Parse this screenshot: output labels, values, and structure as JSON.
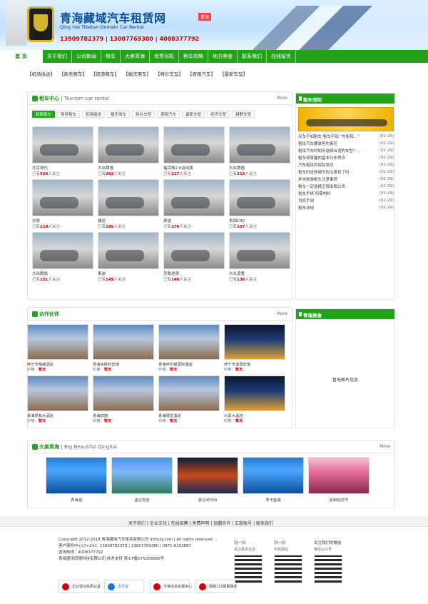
{
  "header": {
    "site_name": "青海藏域汽车租赁网",
    "site_name_en": "Qing Hai Tibetan Domain Car Rental",
    "badge": "青海",
    "hotline": "13909782379 | 13007769380 | 4008377792"
  },
  "nav": {
    "items": [
      "首 页",
      "关于我们",
      "公司新闻",
      "租车",
      "大美青海",
      "优秀司机",
      "租车攻略",
      "地方美食",
      "联系我们",
      "在线留言"
    ]
  },
  "tags": [
    "【机场接送】",
    "【商务租车】",
    "【旅游租车】",
    "【婚庆用车】",
    "【特价车型】",
    "【周租汽车】",
    "【最新车型】"
  ],
  "rent_center": {
    "title": "租车中心",
    "subtitle": "Tourism car rental",
    "more": "More",
    "tabs": [
      "新款租车",
      "商务租车",
      "机场接送",
      "婚庆用车",
      "特价车型",
      "周租汽车",
      "最新车型",
      "经济车型",
      "越野车型"
    ],
    "cars": [
      {
        "name": "北京现代",
        "views": "554"
      },
      {
        "name": "大众朗逸",
        "views": "262"
      },
      {
        "name": "福克斯2.0运动版",
        "views": "217"
      },
      {
        "name": "大众朗逸",
        "views": "215"
      },
      {
        "name": "志俊",
        "views": "210"
      },
      {
        "name": "捷达",
        "views": "195"
      },
      {
        "name": "奥迪",
        "views": "176"
      },
      {
        "name": "本田CRV",
        "views": "157"
      },
      {
        "name": "大众朗逸",
        "views": "151"
      },
      {
        "name": "奥迪",
        "views": "149"
      },
      {
        "name": "尼桑途观",
        "views": "146"
      },
      {
        "name": "大众凌度",
        "views": "136"
      }
    ],
    "views_prefix": "已有",
    "views_suffix": "人关注"
  },
  "rent_notice": {
    "title": "租车须知",
    "items": [
      {
        "text": "买车不如租车  租车不如 “先租后...”",
        "date": "(02-29)"
      },
      {
        "text": "租赁汽车要承担的责任",
        "date": "(02-29)"
      },
      {
        "text": "租赁汽车时如何选择合适的车型？...",
        "date": "(02-29)"
      },
      {
        "text": "租车须掌握的基本行车常识",
        "date": "(02-29)"
      },
      {
        "text": "汽车租赁的保险常识",
        "date": "(02-29)"
      },
      {
        "text": "租车时这些细节你注意到了吗",
        "date": "(02-29)"
      },
      {
        "text": "外地旅游租车注意事项",
        "date": "(02-29)"
      },
      {
        "text": "租车一定选择正规出租公司",
        "date": "(02-29)"
      },
      {
        "text": "租车手续 所需材料",
        "date": "(02-29)"
      },
      {
        "text": "司机手则",
        "date": "(02-29)"
      },
      {
        "text": "租车法规",
        "date": "(02-29)"
      }
    ]
  },
  "partners": {
    "title": "合作伙伴",
    "more": "More",
    "price_label": "价格：",
    "price_value": "暂无",
    "items": [
      "西宁市格威酒店",
      "青海省胜利宾馆",
      "青海伊尔顿国际酒店",
      "西宁市湟源宾馆",
      "青海昆和大酒店",
      "青海宾馆",
      "青海银龙酒店",
      "兴源大酒店"
    ]
  },
  "qinghai_food": {
    "title": "青海美食",
    "no_image": "暂无图片信息"
  },
  "big_qinghai": {
    "title": "大美青海",
    "subtitle": "Big Beautiful Qinghai",
    "more": "More",
    "items": [
      "青海湖",
      "孟达天池",
      "黑马河日出",
      "茶卡盐湖",
      "民和桃花节"
    ]
  },
  "footer": {
    "links": "关于我们 | 企业文化 | 在线招聘 | 免费声明 | 加盟合作 | 汇款账号 | 联系我们",
    "copyright_lines": [
      "Copyright 2012-2018 青海藏域汽车租赁有限公司 qhzyzy.com | All rights reserved",
      "客户服务中心(7×24)：13909782379 | 13007769380 | 0971-6153887",
      "咨询热线：4008377792",
      "青海盛世同德科技有限公司 技术支持  青ICP备075008886号"
    ],
    "qr": [
      {
        "label": "扫一扫",
        "sub": "关注更多信息"
      },
      {
        "label": "扫一扫",
        "sub": "手机网站"
      },
      {
        "label": "关注我们的微信",
        "sub": "微信公众号"
      }
    ],
    "badges": [
      "企业营业执照认证",
      "支付宝",
      "不良信息举报中心",
      "网络110报警服务"
    ]
  }
}
